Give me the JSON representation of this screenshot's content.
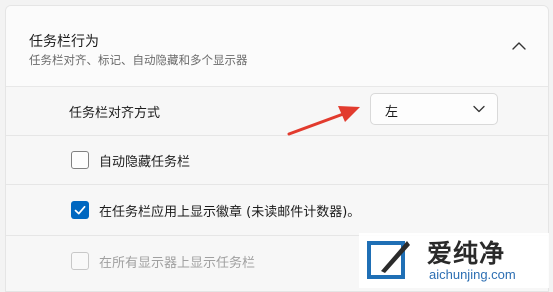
{
  "section": {
    "title": "任务栏行为",
    "subtitle": "任务栏对齐、标记、自动隐藏和多个显示器",
    "expanded": true
  },
  "alignment": {
    "label": "任务栏对齐方式",
    "value": "左"
  },
  "options": [
    {
      "label": "自动隐藏任务栏",
      "checked": false,
      "disabled": false
    },
    {
      "label": "在任务栏应用上显示徽章 (未读邮件计数器)。",
      "checked": true,
      "disabled": false
    },
    {
      "label": "在所有显示器上显示任务栏",
      "checked": false,
      "disabled": true
    }
  ],
  "watermark": {
    "name": "爱纯净",
    "url": "aichunjing.com"
  },
  "colors": {
    "accent": "#0067c0",
    "annotation_arrow": "#e23b2e"
  }
}
